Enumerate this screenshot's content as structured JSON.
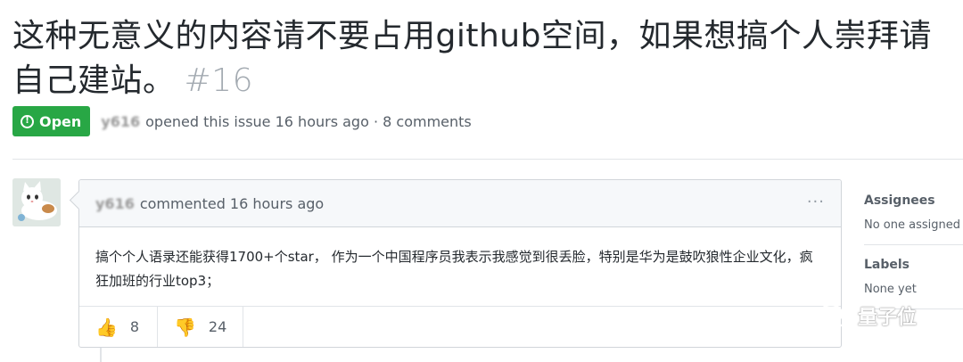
{
  "issue": {
    "title": "这种无意义的内容请不要占用github空间，如果想搞个人崇拜请自己建站。",
    "number": "#16",
    "state": "Open",
    "state_icon": "!",
    "author": "y616",
    "meta": "opened this issue 16 hours ago · 8 comments"
  },
  "comment": {
    "author": "y616",
    "header_text": "commented 16 hours ago",
    "more_icon": "···",
    "body": "搞个个人语录还能获得1700+个star， 作为一个中国程序员我表示我感觉到很丢脸，特别是华为是鼓吹狼性企业文化，疯狂加班的行业top3；",
    "reactions": [
      {
        "emoji": "👍",
        "count": "8",
        "icon": "thumbs-up-icon"
      },
      {
        "emoji": "👎",
        "count": "24",
        "icon": "thumbs-down-icon"
      }
    ]
  },
  "sidebar": {
    "assignees_heading": "Assignees",
    "assignees_value": "No one assigned",
    "labels_heading": "Labels",
    "labels_value": "None yet"
  },
  "watermark": {
    "text": "量子位"
  },
  "colors": {
    "open_green": "#28a745",
    "border": "#d1d5da",
    "muted": "#586069"
  }
}
